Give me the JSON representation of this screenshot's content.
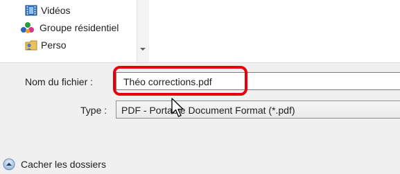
{
  "nav": {
    "items": [
      {
        "label": "Vidéos",
        "icon": "video-library-icon"
      },
      {
        "label": "Groupe résidentiel",
        "icon": "homegroup-icon"
      },
      {
        "label": "Perso",
        "icon": "user-folder-icon"
      }
    ]
  },
  "form": {
    "filename_label": "Nom du fichier :",
    "filename_value": "Théo corrections.pdf",
    "type_label": "Type :",
    "type_value": "PDF - Portable Document Format (*.pdf)"
  },
  "footer": {
    "hide_folders_label": "Cacher les dossiers",
    "icon": "chevron-up-circle-icon"
  },
  "colors": {
    "highlight": "#e8000b",
    "window_bg": "#f0f0f0"
  }
}
